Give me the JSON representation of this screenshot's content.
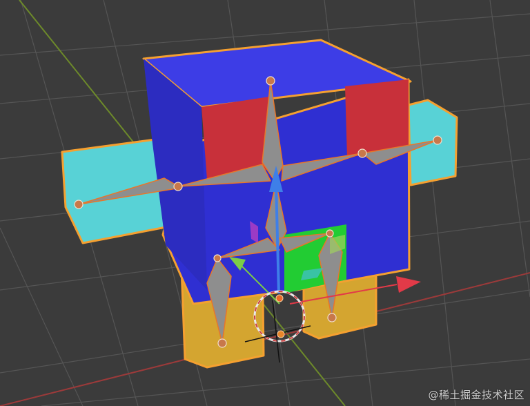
{
  "viewport": {
    "background": "#3b3b3b",
    "grid_color": "#555555",
    "x_axis_color": "#9c3a3a",
    "y_axis_color": "#6d8a2a"
  },
  "model": {
    "selection_outline": "#f5a030",
    "colors": {
      "body_top": "#3d3de6",
      "body_front": "#2f2fd2",
      "body_side": "#3333c8",
      "red_panel": "#c8303a",
      "arm_cyan": "#58d2d6",
      "arm_cyan_side": "#3fb8be",
      "leg_yellow": "#d4a530",
      "green_panel": "#22cc33",
      "bone_fill": "#8e8e8e",
      "bone_outline": "#e8762a",
      "joint": "#c8784a"
    }
  },
  "gizmo": {
    "arrow_up_color": "#3e7fe8",
    "arrow_x_color": "#e23a48",
    "arrow_y_color": "#7ccd45",
    "cursor_ring_color": "#e8e8e8"
  },
  "watermark": "@稀土掘金技术社区"
}
